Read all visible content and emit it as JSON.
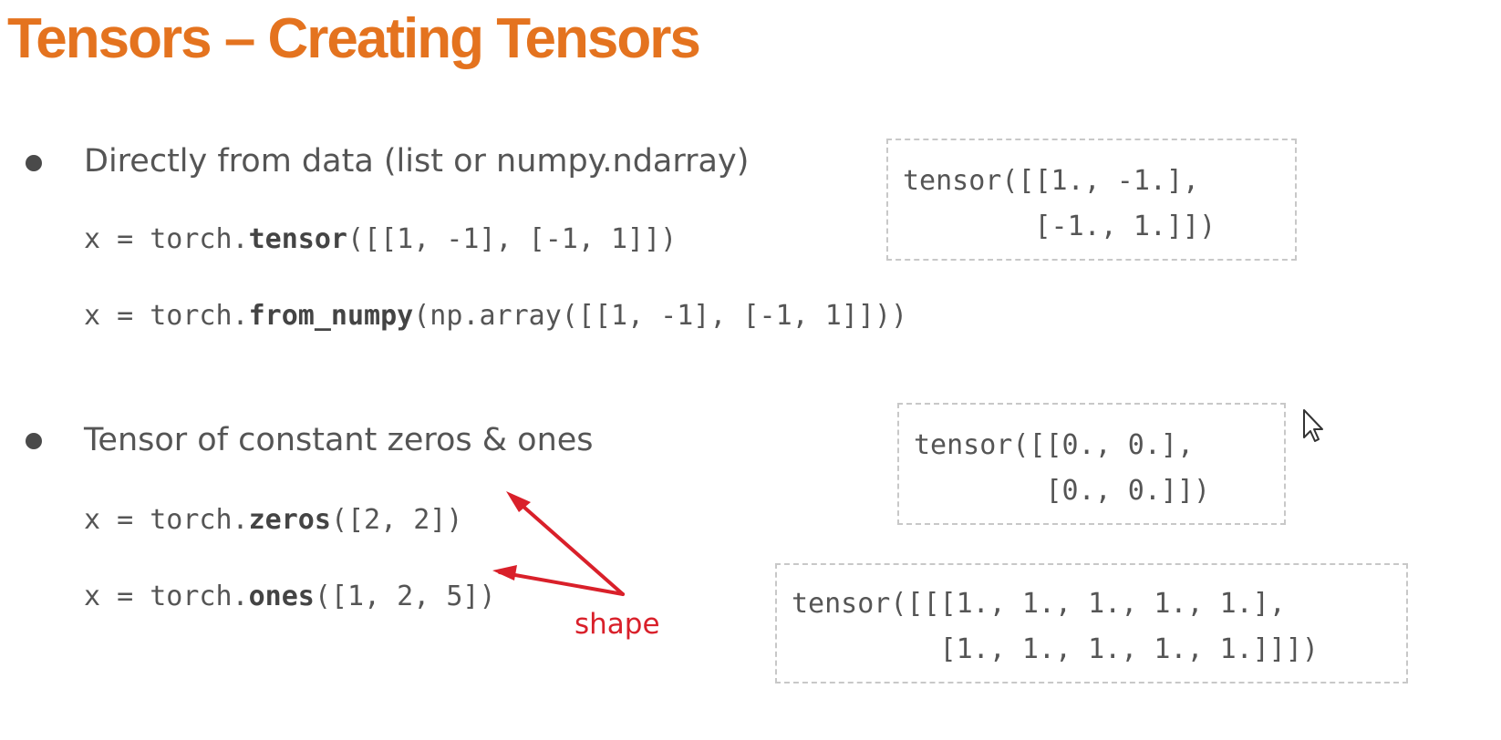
{
  "slide": {
    "title": "Tensors – Creating Tensors",
    "sections": [
      {
        "bullet": "Directly from data (list or numpy.ndarray)",
        "code": [
          {
            "pre": "x = torch.",
            "fn": "tensor",
            "post": "([[1, -1], [-1, 1]])"
          },
          {
            "pre": "x = torch.",
            "fn": "from_numpy",
            "post": "(np.array([[1, -1], [-1, 1]]))"
          }
        ],
        "outputs": [
          {
            "lines": [
              "tensor([[1., -1.],",
              "        [-1., 1.]])"
            ]
          }
        ]
      },
      {
        "bullet": "Tensor of constant zeros & ones",
        "code": [
          {
            "pre": "x = torch.",
            "fn": "zeros",
            "post": "([2, 2])"
          },
          {
            "pre": "x = torch.",
            "fn": "ones",
            "post": "([1, 2, 5])"
          }
        ],
        "outputs": [
          {
            "lines": [
              "tensor([[0., 0.],",
              "        [0., 0.]])"
            ]
          },
          {
            "lines": [
              "tensor([[[1., 1., 1., 1., 1.],",
              "         [1., 1., 1., 1., 1.]]])"
            ]
          }
        ]
      }
    ],
    "annotation": {
      "label": "shape",
      "color": "#d9202a"
    },
    "colors": {
      "title": "#e4731f",
      "body_text": "#555555",
      "box_border": "#c8c8c8"
    },
    "cursor_icon": "mouse-pointer-icon"
  }
}
